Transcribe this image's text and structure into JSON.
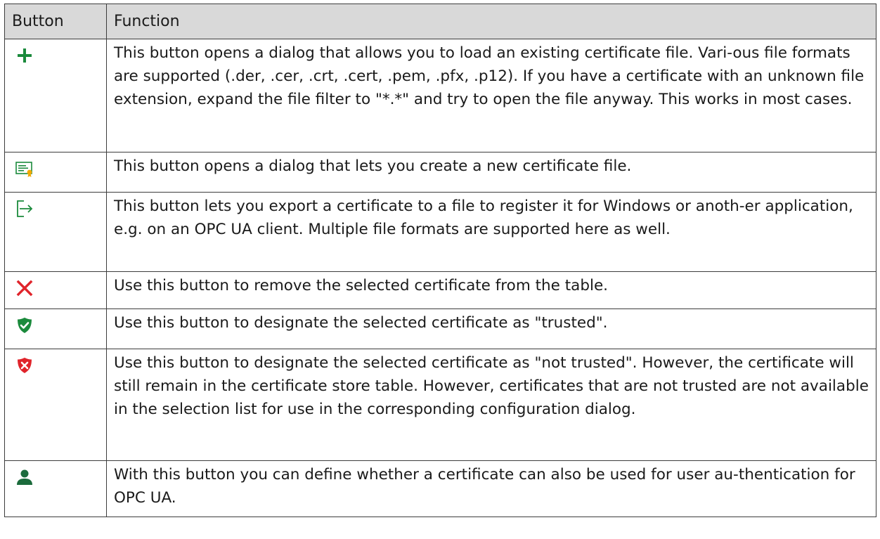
{
  "table": {
    "headers": {
      "button": "Button",
      "function": "Function"
    },
    "rows": [
      {
        "icon": "plus-icon",
        "icon_color": "#1b8a3c",
        "text": "This button opens a dialog that allows you to load an existing certificate file. Vari-ous file formats are supported (.der, .cer, .crt, .cert, .pem, .pfx, .p12). If you have a certificate with an unknown file extension, expand the file filter to \"*.*\" and try to open the file anyway. This works in most cases."
      },
      {
        "icon": "new-certificate-icon",
        "icon_color": "#1b8a3c",
        "text": "This button opens a dialog that lets you create a new certificate file."
      },
      {
        "icon": "export-icon",
        "icon_color": "#1b8a3c",
        "text": "This button lets you export a certificate to a file to register it for Windows or anoth-er application, e.g. on an OPC UA client. Multiple file formats are supported here as well."
      },
      {
        "icon": "remove-x-icon",
        "icon_color": "#e0242b",
        "text": "Use this button to remove the selected certificate from the table."
      },
      {
        "icon": "shield-check-icon",
        "icon_color": "#1b8a3c",
        "text": "Use this button to designate the selected certificate as \"trusted\"."
      },
      {
        "icon": "shield-x-icon",
        "icon_color": "#e0242b",
        "text": "Use this button to designate the selected certificate as \"not trusted\". However, the certificate will still remain in the certificate store table. However, certificates that are not trusted are not available in the selection list for use in the corresponding configuration dialog."
      },
      {
        "icon": "user-icon",
        "icon_color": "#1b6b3c",
        "text": "With this button you can define whether a certificate can also be used for user au-thentication for OPC UA."
      }
    ]
  }
}
